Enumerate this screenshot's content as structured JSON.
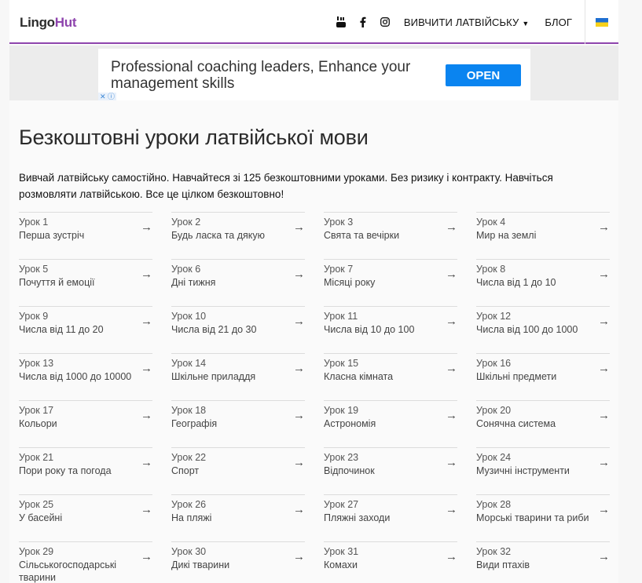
{
  "header": {
    "logo_part1": "Lingo",
    "logo_part2": "Hut",
    "learn_menu": "ВИВЧИТИ ЛАТВІЙСЬКУ",
    "blog": "БЛОГ"
  },
  "ad": {
    "text": "Professional coaching leaders, Enhance your management skills",
    "button": "OPEN",
    "choices": "✕ ⓘ"
  },
  "page_title": "Безкоштовні уроки латвійської мови",
  "intro": "Вивчай латвійську самостійно. Навчайтеся зі 125 безкоштовними уроками. Без ризику і контракту. Навчіться розмовляти латвійською. Все це цілком безкоштовно!",
  "arrow": "→",
  "lessons": [
    {
      "num": "Урок 1",
      "name": "Перша зустріч"
    },
    {
      "num": "Урок 2",
      "name": "Будь ласка та дякую"
    },
    {
      "num": "Урок 3",
      "name": "Свята та вечірки"
    },
    {
      "num": "Урок 4",
      "name": "Мир на землі"
    },
    {
      "num": "Урок 5",
      "name": "Почуття й емоції"
    },
    {
      "num": "Урок 6",
      "name": "Дні тижня"
    },
    {
      "num": "Урок 7",
      "name": "Місяці року"
    },
    {
      "num": "Урок 8",
      "name": "Числа від 1 до 10"
    },
    {
      "num": "Урок 9",
      "name": "Числа від 11 до 20"
    },
    {
      "num": "Урок 10",
      "name": "Числа від 21 до 30"
    },
    {
      "num": "Урок 11",
      "name": "Числа від 10 до 100"
    },
    {
      "num": "Урок 12",
      "name": "Числа від 100 до 1000"
    },
    {
      "num": "Урок 13",
      "name": "Числа від 1000 до 10000"
    },
    {
      "num": "Урок 14",
      "name": "Шкільне приладдя"
    },
    {
      "num": "Урок 15",
      "name": "Класна кімната"
    },
    {
      "num": "Урок 16",
      "name": "Шкільні предмети"
    },
    {
      "num": "Урок 17",
      "name": "Кольори"
    },
    {
      "num": "Урок 18",
      "name": "Географія"
    },
    {
      "num": "Урок 19",
      "name": "Астрономія"
    },
    {
      "num": "Урок 20",
      "name": "Сонячна система"
    },
    {
      "num": "Урок 21",
      "name": "Пори року та погода"
    },
    {
      "num": "Урок 22",
      "name": "Спорт"
    },
    {
      "num": "Урок 23",
      "name": "Відпочинок"
    },
    {
      "num": "Урок 24",
      "name": "Музичні інструменти"
    },
    {
      "num": "Урок 25",
      "name": "У басейні"
    },
    {
      "num": "Урок 26",
      "name": "На пляжі"
    },
    {
      "num": "Урок 27",
      "name": "Пляжні заходи"
    },
    {
      "num": "Урок 28",
      "name": "Морські тварини та риби"
    },
    {
      "num": "Урок 29",
      "name": "Сільськогосподарські тварини"
    },
    {
      "num": "Урок 30",
      "name": "Дикі тварини"
    },
    {
      "num": "Урок 31",
      "name": "Комахи"
    },
    {
      "num": "Урок 32",
      "name": "Види птахів"
    }
  ]
}
